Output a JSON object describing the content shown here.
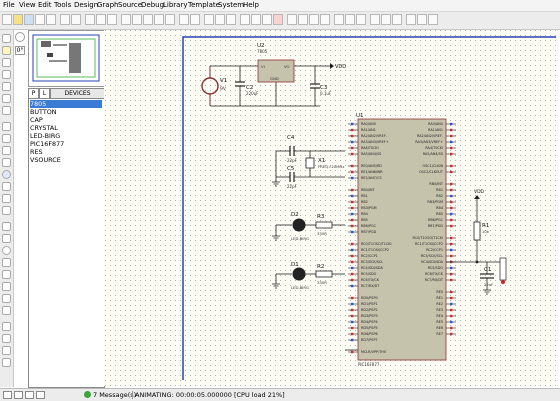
{
  "menu": [
    "File",
    "View",
    "Edit",
    "Tools",
    "Design",
    "Graph",
    "Source",
    "Debug",
    "Library",
    "Template",
    "System",
    "Help"
  ],
  "picker": {
    "tab_p": "P",
    "tab_l": "L",
    "header": "DEVICES"
  },
  "devices": [
    "7805",
    "BUTTON",
    "CAP",
    "CRYSTAL",
    "LED-BIRG",
    "PIC16F877",
    "RES",
    "VSOURCE"
  ],
  "selected_device": "7805",
  "schematic": {
    "u2_ref": "U2",
    "u2_part": "7805",
    "u2_vi": "VI",
    "u2_vo": "VO",
    "u2_gnd": "GND",
    "vdd_top": "VDD",
    "vdd_right": "VDD",
    "v1_ref": "V1",
    "v1_val": "9V",
    "c2_ref": "C2",
    "c2_val": "220uF",
    "c3_ref": "C3",
    "c3_val": "0.1uF",
    "c4_ref": "C4",
    "c4_val": "22pF",
    "c5_ref": "C5",
    "c5_val": "22pF",
    "x1_ref": "X1",
    "x1_val": "FREQ=20MHz",
    "u1_ref": "U1",
    "u1_part": "PIC16F877",
    "d2_ref": "D2",
    "d2_part": "LED-BIRG",
    "d1_ref": "D1",
    "d1_part": "LED-BIRG",
    "r3_ref": "R3",
    "r3_val": "330R",
    "r2_ref": "R2",
    "r2_val": "330R",
    "r1_ref": "R1",
    "r1_val": "10k",
    "c1_ref": "C1",
    "c1_val": "22nF",
    "text_tag": "<TEXT>"
  },
  "u1_left_pins": [
    "RA0/AN0",
    "RA1/AN1",
    "RA2/AN2/VREF-",
    "RA3/AN3/VREF+",
    "RA4/T0CKI",
    "RA5/AN4/SS",
    "",
    "RE0/AN5/RD",
    "RE1/AN6/WR",
    "RE2/AN7/CS",
    "",
    "RB0/INT",
    "RB1",
    "RB2",
    "RB3/PGM",
    "RB4",
    "RB5",
    "RB6/PGC",
    "RB7/PGD",
    "",
    "RC0/T1OSO/T1CKI",
    "RC1/T1OSI/CCP2",
    "RC2/CCP1",
    "RC3/SCK/SCL",
    "RC4/SDI/SDA",
    "RC5/SDO",
    "RC6/TX/CK",
    "RC7/RX/DT",
    "",
    "RD0/PSP0",
    "RD1/PSP1",
    "RD2/PSP2",
    "RD3/PSP3",
    "RD4/PSP4",
    "RD5/PSP5",
    "RD6/PSP6",
    "RD7/PSP7",
    "",
    "MCLR/VPP/THV"
  ],
  "u1_right_pins": [
    "RA0/AN0",
    "RA1/AN1",
    "RA2/AN2/VREF-",
    "RA3/AN3/VREF+",
    "RA4/T0CKI",
    "RA5/AN4/SS",
    "",
    "OSC1/CLKIN",
    "OSC2/CLKOUT",
    "",
    "RB0/INT",
    "RB1",
    "RB2",
    "RB3/PGM",
    "RB4",
    "RB5",
    "RB6/PGC",
    "RB7/PGD",
    "",
    "RC0/T1OSO/T1CKI",
    "RC1/T1OSI/CCP2",
    "RC2/CCP1",
    "RC3/SCK/SCL",
    "RC4/SDI/SDA",
    "RC5/SDO",
    "RC6/TX/CK",
    "RC7/RX/DT",
    "",
    "RE0",
    "RE1",
    "RE2",
    "RE3",
    "RE4",
    "RE5",
    "RE6",
    "RE7"
  ],
  "status": {
    "messages": "7 Message(s)",
    "animating": "ANIMATING: 00:00:05.000000 [CPU load 21%]"
  }
}
